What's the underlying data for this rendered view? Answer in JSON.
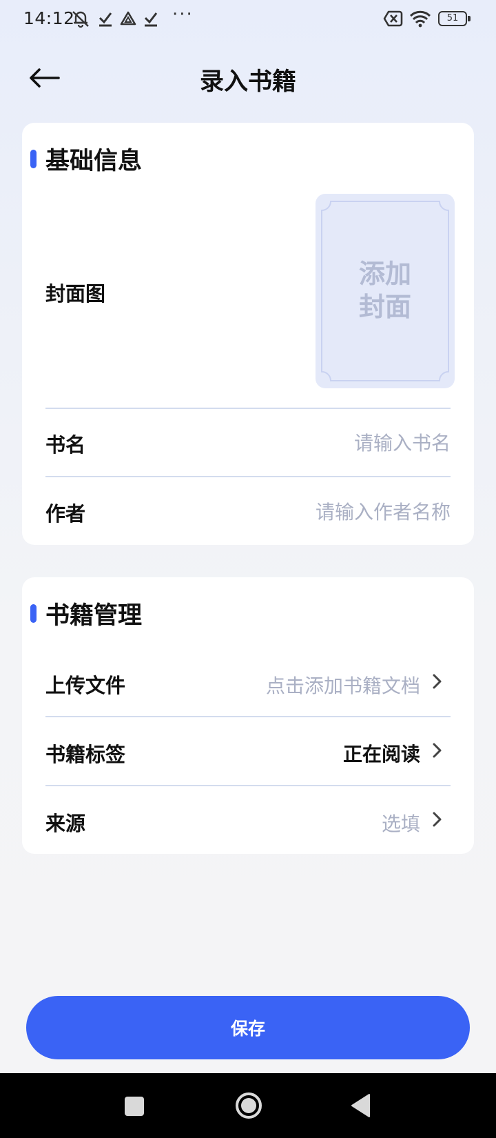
{
  "status_bar": {
    "time": "14:12",
    "battery": "51",
    "icons": [
      "mute-icon",
      "check-icon",
      "drive-icon",
      "check-icon",
      "more-icon",
      "sim-off-icon",
      "wifi-icon",
      "battery-icon"
    ],
    "more": "···"
  },
  "header": {
    "title": "录入书籍",
    "back_icon": "arrow-left-icon"
  },
  "basic_info": {
    "title": "基础信息",
    "cover": {
      "label": "封面图",
      "placeholder_line1": "添加",
      "placeholder_line2": "封面"
    },
    "book_name": {
      "label": "书名",
      "value": "",
      "placeholder": "请输入书名"
    },
    "author": {
      "label": "作者",
      "value": "",
      "placeholder": "请输入作者名称"
    }
  },
  "management": {
    "title": "书籍管理",
    "rows": [
      {
        "label": "上传文件",
        "value": "点击添加书籍文档",
        "state": "placeholder"
      },
      {
        "label": "书籍标签",
        "value": "正在阅读",
        "state": "filled"
      },
      {
        "label": "来源",
        "value": "选填",
        "state": "placeholder"
      }
    ]
  },
  "save_button": {
    "label": "保存"
  },
  "colors": {
    "accent": "#3a63f5",
    "placeholder_text": "#aab0c4",
    "divider": "#d3dcee",
    "cover_bg": "#e4e9f9"
  },
  "system_nav": {
    "buttons": [
      "recents-icon",
      "home-icon",
      "back-icon"
    ]
  }
}
